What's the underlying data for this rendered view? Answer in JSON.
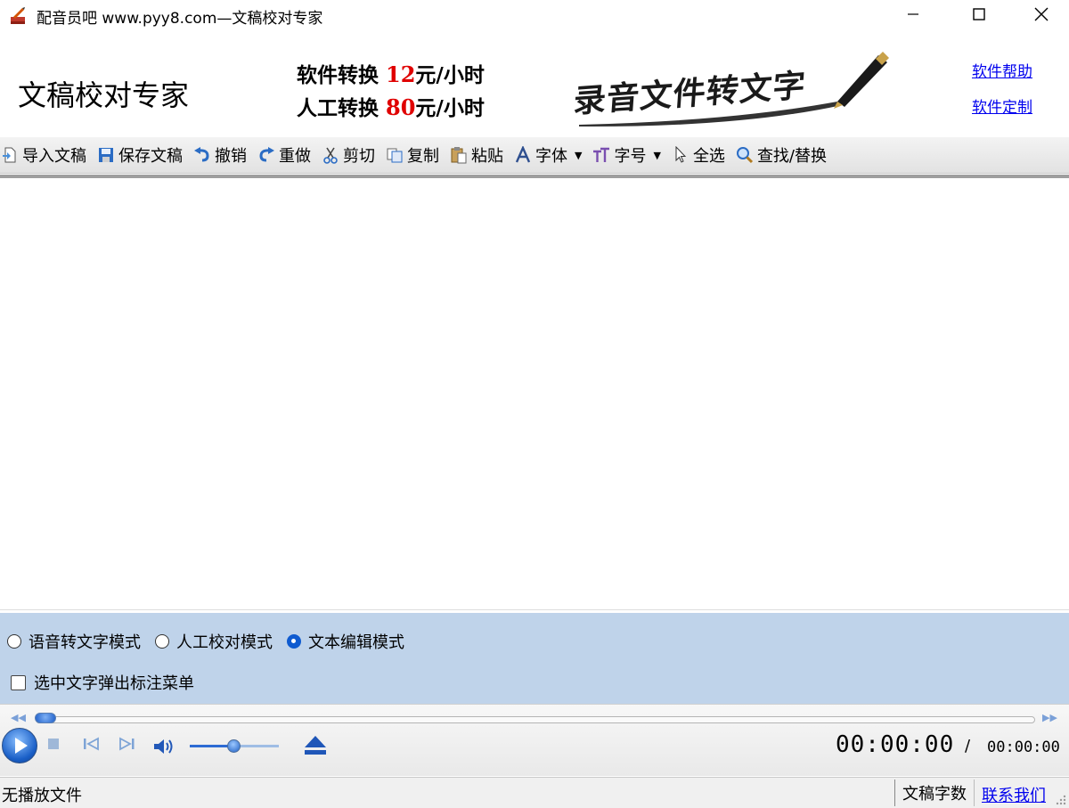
{
  "window": {
    "title": "配音员吧 www.pyy8.com—文稿校对专家",
    "minimize_icon": "minimize-icon",
    "maximize_icon": "maximize-icon",
    "close_icon": "close-icon"
  },
  "banner": {
    "app_name": "文稿校对专家",
    "promo_line1_prefix": "软件转换 ",
    "promo_line1_price": "12",
    "promo_line1_suffix": "元/小时",
    "promo_line2_prefix": "人工转换 ",
    "promo_line2_price": "80",
    "promo_line2_suffix": "元/小时",
    "slogan": "录音文件转文字",
    "link_help": "软件帮助",
    "link_custom": "软件定制",
    "price_color": "#e00000"
  },
  "toolbar": {
    "items": [
      {
        "label": "导入文稿",
        "icon": "import-doc-icon"
      },
      {
        "label": "保存文稿",
        "icon": "save-icon"
      },
      {
        "label": "撤销",
        "icon": "undo-icon"
      },
      {
        "label": "重做",
        "icon": "redo-icon"
      },
      {
        "label": "剪切",
        "icon": "cut-icon"
      },
      {
        "label": "复制",
        "icon": "copy-icon"
      },
      {
        "label": "粘贴",
        "icon": "paste-icon"
      },
      {
        "label": "字体",
        "icon": "font-icon"
      },
      {
        "label": "字号",
        "icon": "font-size-icon"
      },
      {
        "label": "全选",
        "icon": "select-all-icon"
      },
      {
        "label": "查找/替换",
        "icon": "find-replace-icon"
      }
    ]
  },
  "editor": {
    "content": ""
  },
  "modes": {
    "options": [
      {
        "label": "语音转文字模式",
        "selected": false
      },
      {
        "label": "人工校对模式",
        "selected": false
      },
      {
        "label": "文本编辑模式",
        "selected": true
      }
    ],
    "popup_checkbox_label": "选中文字弹出标注菜单",
    "popup_checkbox_checked": false,
    "panel_color": "#bfd3ea"
  },
  "player": {
    "current_time": "00:00:00",
    "separator": "/",
    "total_time": "00:00:00",
    "seek_progress": 0,
    "volume_level": 0.5,
    "accent_color": "#1c5dc8"
  },
  "status": {
    "file_status": "无播放文件",
    "word_count_label": "文稿字数",
    "contact_link": "联系我们"
  }
}
